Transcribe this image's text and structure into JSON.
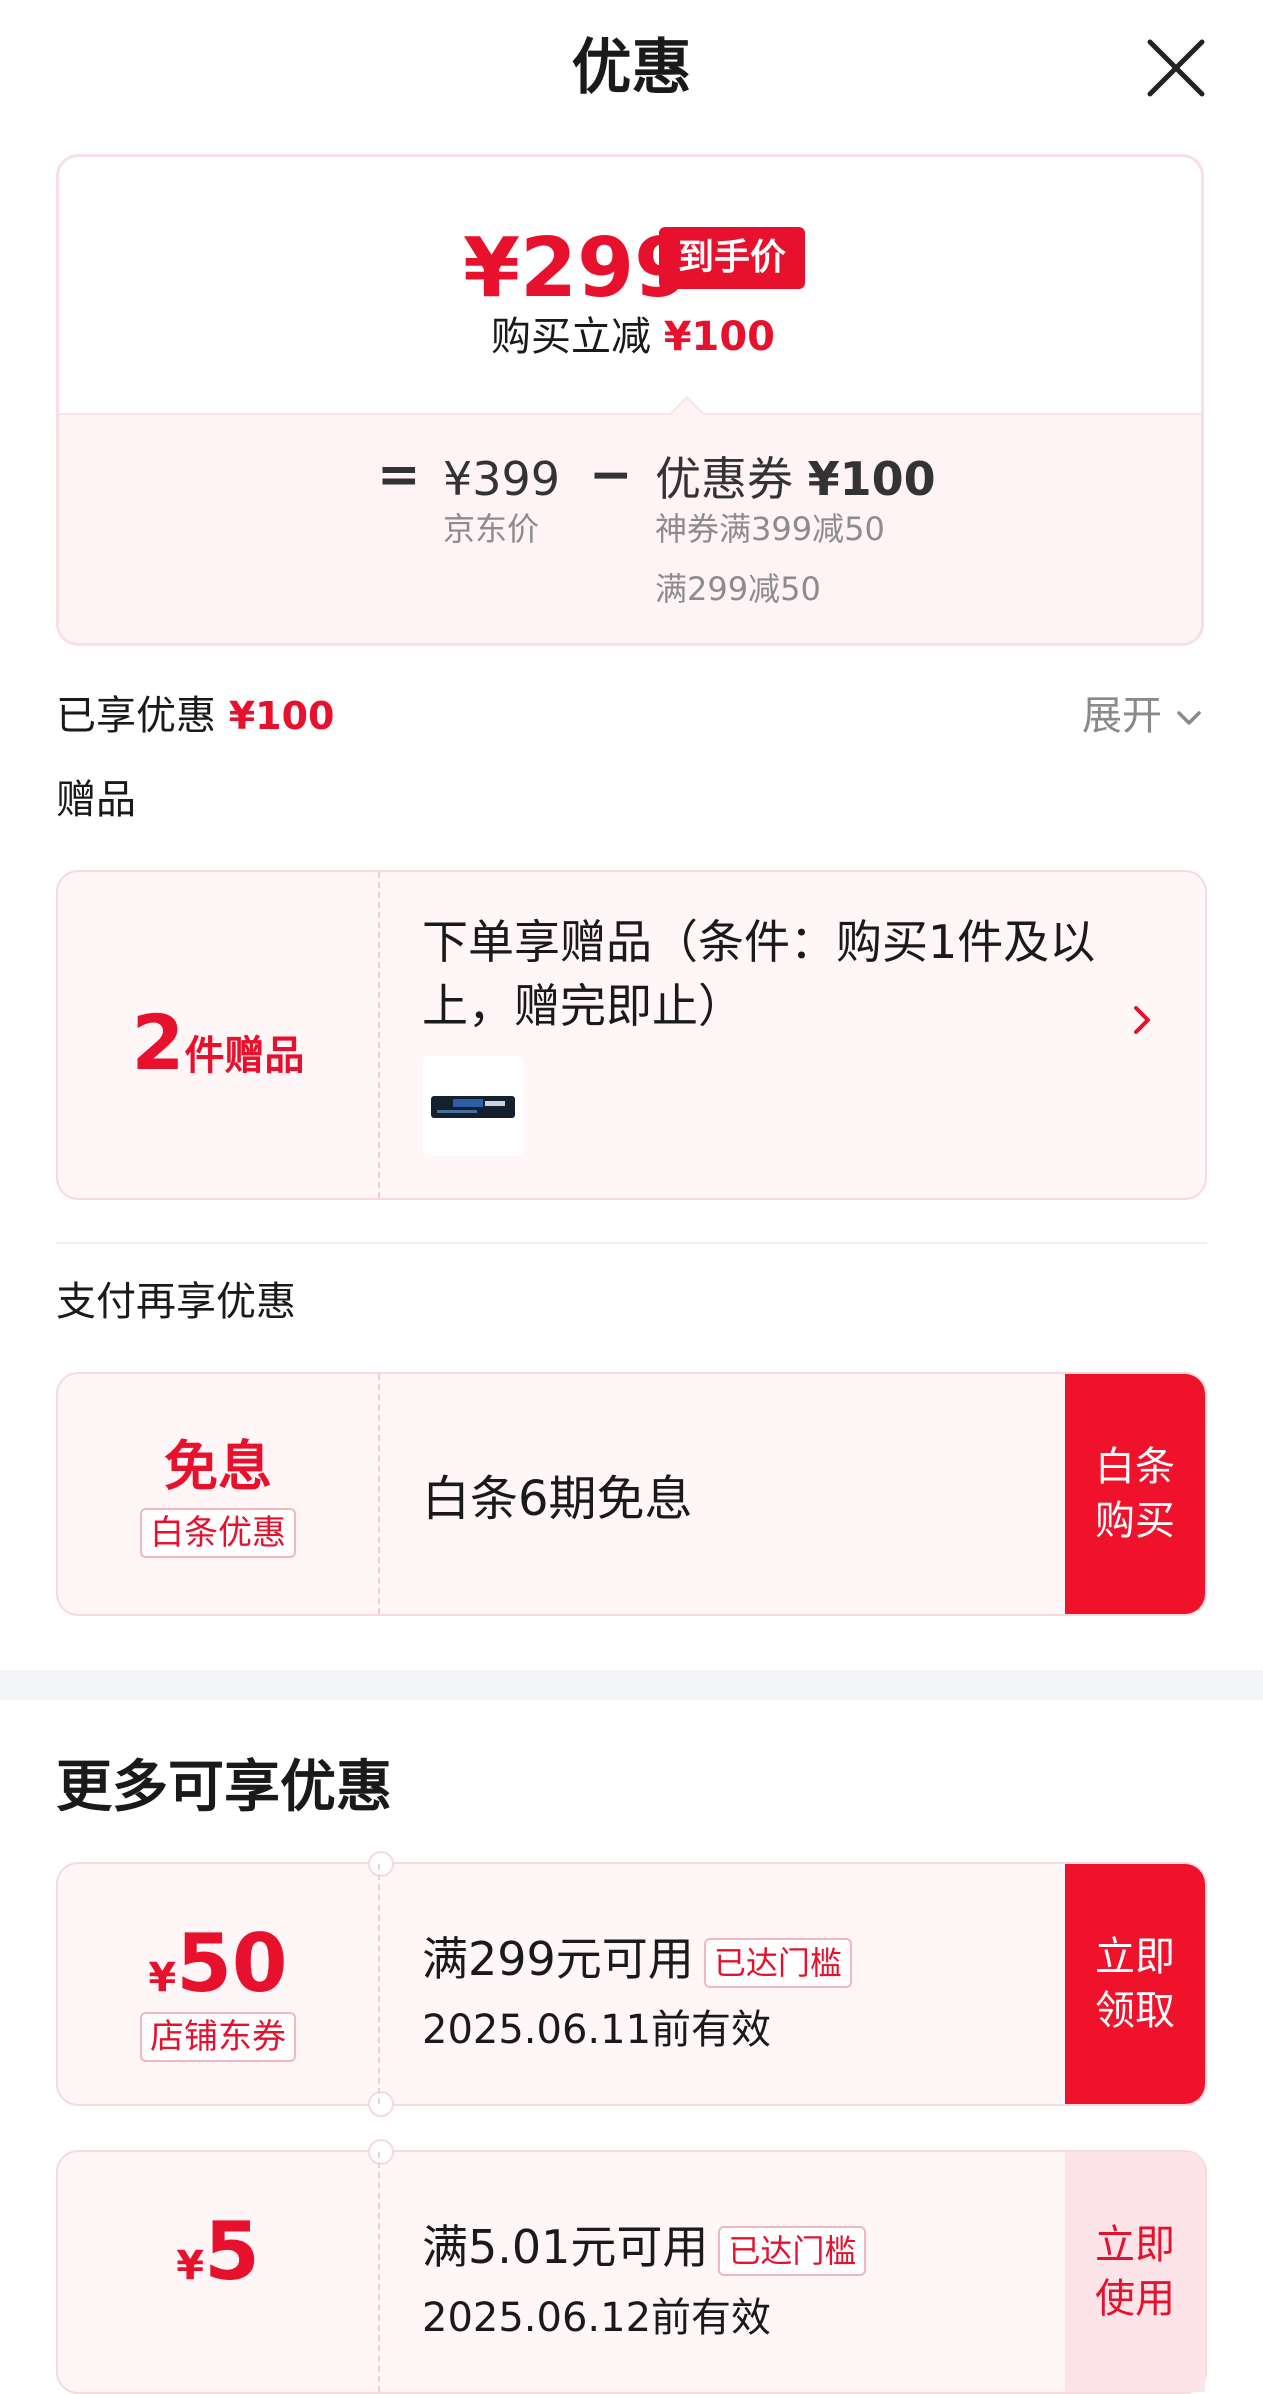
{
  "header": {
    "title": "优惠",
    "close_icon": "close-icon"
  },
  "price_card": {
    "final_price": "¥299",
    "final_price_badge": "到手价",
    "cut_label": "购买立减",
    "cut_value": "¥100",
    "calc": {
      "equals": "=",
      "jd_price": "¥399",
      "jd_price_label": "京东价",
      "minus": "−",
      "coupon_label": "优惠券",
      "coupon_value": "¥100",
      "details": [
        "神券满399减50",
        "满299减50"
      ]
    }
  },
  "enjoyed": {
    "label": "已享优惠",
    "value": "¥100",
    "expand_label": "展开"
  },
  "gift_section": {
    "label": "赠品",
    "count": "2",
    "count_unit": "件赠品",
    "text": "下单享赠品（条件：购买1件及以上，赠完即止）"
  },
  "pay_section": {
    "label": "支付再享优惠",
    "big": "免息",
    "tag": "白条优惠",
    "text": "白条6期免息",
    "action_line1": "白条",
    "action_line2": "购买"
  },
  "more_title": "更多可享优惠",
  "coupons": [
    {
      "currency": "¥",
      "amount": "50",
      "type": "店铺东券",
      "condition": "满299元可用",
      "status": "已达门槛",
      "validity": "2025.06.11前有效",
      "action_line1": "立即",
      "action_line2": "领取"
    },
    {
      "currency": "¥",
      "amount": "5",
      "condition": "满5.01元可用",
      "status": "已达门槛",
      "validity": "2025.06.12前有效",
      "action_line1": "立即",
      "action_line2": "使用"
    }
  ],
  "colors": {
    "accent": "#e8112d",
    "card_bg": "#fff6f7",
    "border": "#f6dadd"
  }
}
